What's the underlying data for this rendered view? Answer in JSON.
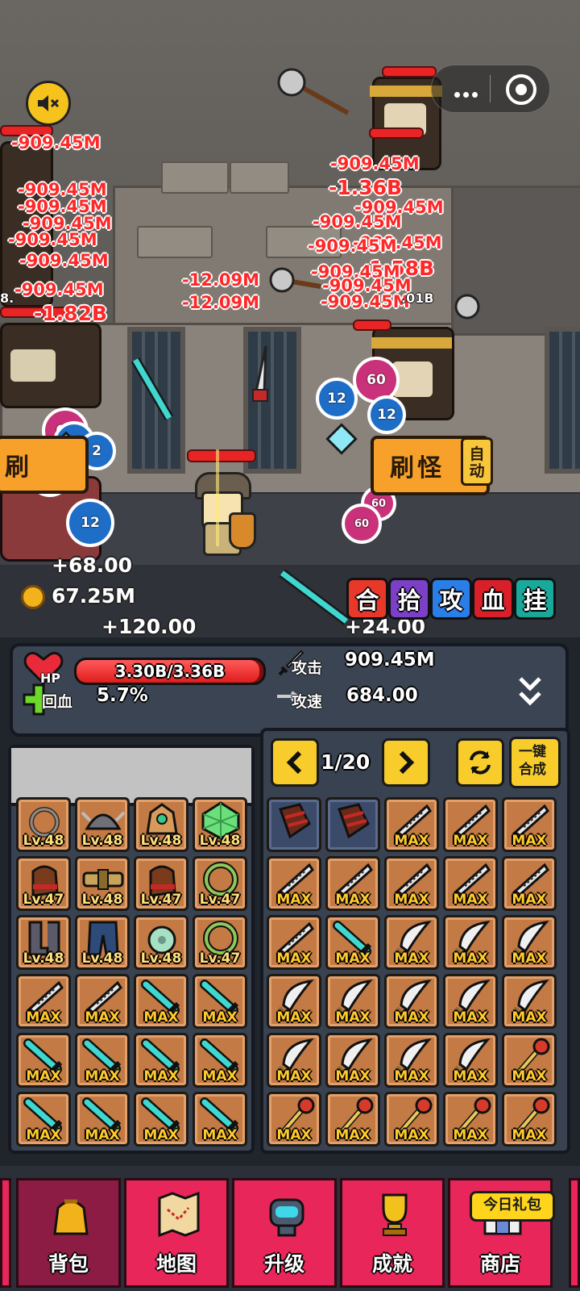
{
  "battle": {
    "damage_numbers": [
      "-909.45M",
      "-909.45M",
      "-909.45M",
      "-909.45M",
      "-909.45M",
      "-909.45M",
      "-909.45M",
      "-1.82B",
      "-12.09M",
      "-12.09M",
      "-909.45M",
      "-1.36B",
      "-909.45M",
      "-909.45M",
      "-909.45M",
      "-1.58B",
      "-909.45M",
      "-909.45M",
      "-909.45M",
      "-909.45M"
    ],
    "enemy_hp_partial": ".01B",
    "enemy_hp_partial_left": "8.",
    "coin_drops": [
      "60",
      "12",
      "2",
      "12",
      "60",
      "60",
      "12",
      "60",
      "12",
      "60"
    ],
    "gain_left": "+68.00",
    "gain_center": "+120.00",
    "gain_right": "+24.00",
    "gold": "67.25M",
    "farm_button_label": "刷怪",
    "farm_button_label_left": "刷",
    "auto_label": "自动"
  },
  "quick_buttons": [
    {
      "label": "合",
      "color": "#e8382a"
    },
    {
      "label": "拾",
      "color": "#7b3fc8"
    },
    {
      "label": "攻",
      "color": "#2a7ee8"
    },
    {
      "label": "血",
      "color": "#d8202a"
    },
    {
      "label": "挂",
      "color": "#1aa89a"
    }
  ],
  "stats": {
    "hp_icon_label": "HP",
    "hp_text": "3.30B/3.36B",
    "hp_ratio": 0.98,
    "regen_label": "回血",
    "regen_value": "5.7%",
    "attack_label": "攻击",
    "attack_value": "909.45M",
    "attack_speed_label": "攻速",
    "attack_speed_value": "684.00"
  },
  "storage": {
    "page": "1/20",
    "merge_label": "一键合成"
  },
  "equipment": [
    {
      "icon": "rope-icon",
      "tag": "Lv.48"
    },
    {
      "icon": "helmet-icon",
      "tag": "Lv.48"
    },
    {
      "icon": "crown-icon",
      "tag": "Lv.48"
    },
    {
      "icon": "gem-icon",
      "tag": "Lv.48"
    },
    {
      "icon": "glove-icon",
      "tag": "Lv.47"
    },
    {
      "icon": "belt-icon",
      "tag": "Lv.48"
    },
    {
      "icon": "glove-icon",
      "tag": "Lv.47"
    },
    {
      "icon": "wreath-icon",
      "tag": "Lv.47"
    },
    {
      "icon": "boots-icon",
      "tag": "Lv.48"
    },
    {
      "icon": "pants-icon",
      "tag": "Lv.48"
    },
    {
      "icon": "jade-amulet-icon",
      "tag": "Lv.48"
    },
    {
      "icon": "wreath-icon",
      "tag": "Lv.47"
    },
    {
      "icon": "blade-icon",
      "tag": "MAX"
    },
    {
      "icon": "blade-icon",
      "tag": "MAX"
    },
    {
      "icon": "cyan-sword-icon",
      "tag": "MAX"
    },
    {
      "icon": "cyan-sword-icon",
      "tag": "MAX"
    },
    {
      "icon": "cyan-sword-icon",
      "tag": "MAX"
    },
    {
      "icon": "cyan-sword-icon",
      "tag": "MAX"
    },
    {
      "icon": "cyan-sword-icon",
      "tag": "MAX"
    },
    {
      "icon": "cyan-sword-icon",
      "tag": "MAX"
    },
    {
      "icon": "cyan-sword-icon",
      "tag": "MAX"
    },
    {
      "icon": "cyan-sword-icon",
      "tag": "MAX"
    },
    {
      "icon": "cyan-sword-icon",
      "tag": "MAX"
    },
    {
      "icon": "cyan-sword-icon",
      "tag": "MAX"
    }
  ],
  "inventory": [
    {
      "icon": "bracer-icon",
      "tag": ""
    },
    {
      "icon": "bracer-icon",
      "tag": ""
    },
    {
      "icon": "blade-icon",
      "tag": "MAX"
    },
    {
      "icon": "blade-icon",
      "tag": "MAX"
    },
    {
      "icon": "blade-icon",
      "tag": "MAX"
    },
    {
      "icon": "blade-icon",
      "tag": "MAX"
    },
    {
      "icon": "blade-icon",
      "tag": "MAX"
    },
    {
      "icon": "blade-icon",
      "tag": "MAX"
    },
    {
      "icon": "blade-icon",
      "tag": "MAX"
    },
    {
      "icon": "blade-icon",
      "tag": "MAX"
    },
    {
      "icon": "blade-icon",
      "tag": "MAX"
    },
    {
      "icon": "cyan-sword-icon",
      "tag": "MAX"
    },
    {
      "icon": "dagger-icon",
      "tag": "MAX"
    },
    {
      "icon": "dagger-icon",
      "tag": "MAX"
    },
    {
      "icon": "dagger-icon",
      "tag": "MAX"
    },
    {
      "icon": "dagger-icon",
      "tag": "MAX"
    },
    {
      "icon": "dagger-icon",
      "tag": "MAX"
    },
    {
      "icon": "dagger-icon",
      "tag": "MAX"
    },
    {
      "icon": "dagger-icon",
      "tag": "MAX"
    },
    {
      "icon": "dagger-icon",
      "tag": "MAX"
    },
    {
      "icon": "dagger-icon",
      "tag": "MAX"
    },
    {
      "icon": "dagger-icon",
      "tag": "MAX"
    },
    {
      "icon": "dagger-icon",
      "tag": "MAX"
    },
    {
      "icon": "dagger-icon",
      "tag": "MAX"
    },
    {
      "icon": "scepter-icon",
      "tag": "MAX"
    },
    {
      "icon": "scepter-icon",
      "tag": "MAX"
    },
    {
      "icon": "scepter-icon",
      "tag": "MAX"
    },
    {
      "icon": "scepter-icon",
      "tag": "MAX"
    },
    {
      "icon": "scepter-icon",
      "tag": "MAX"
    },
    {
      "icon": "scepter-icon",
      "tag": "MAX"
    }
  ],
  "nav": {
    "tabs": [
      {
        "label": "背包",
        "icon": "bag-icon",
        "active": true
      },
      {
        "label": "地图",
        "icon": "map-icon",
        "active": false
      },
      {
        "label": "升级",
        "icon": "robot-icon",
        "active": false
      },
      {
        "label": "成就",
        "icon": "trophy-icon",
        "active": false
      },
      {
        "label": "商店",
        "icon": "shop-icon",
        "active": false
      }
    ],
    "gift_badge": "今日礼包"
  }
}
